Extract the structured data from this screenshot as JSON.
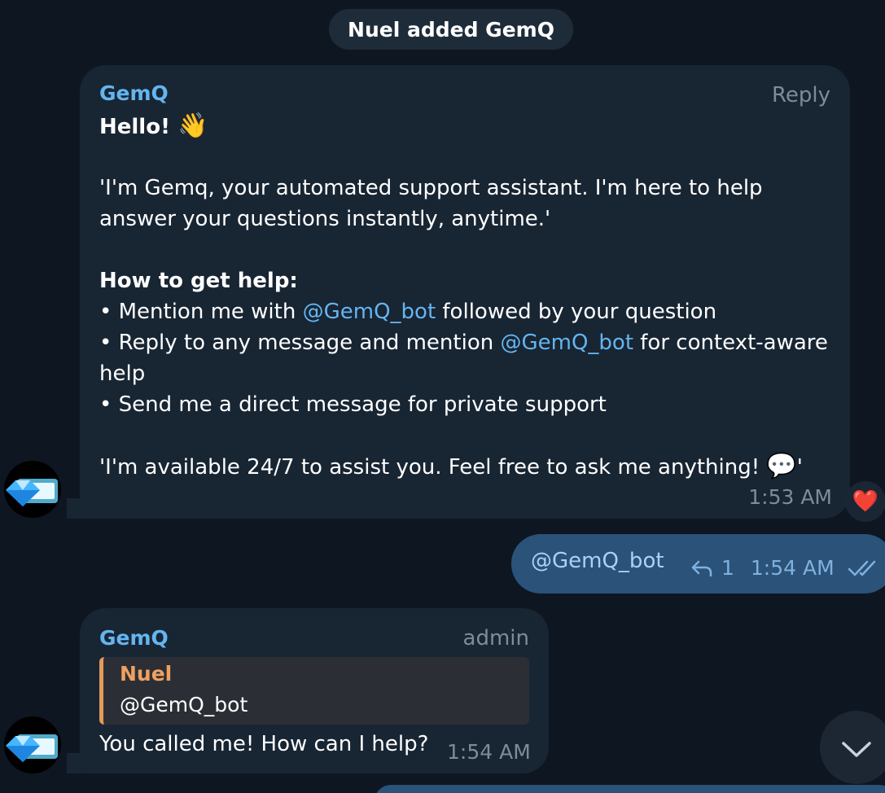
{
  "service_message": "Nuel added GemQ",
  "message1": {
    "sender": "GemQ",
    "reply_label": "Reply",
    "greeting": "Hello!",
    "greeting_emoji": "👋",
    "intro_line1": "'I'm Gemq, your automated support assistant. I'm here to help",
    "intro_line2": "answer your questions instantly, anytime.'",
    "how_to_title": "How to get help:",
    "bullet1_pre": "• Mention me with ",
    "bullet1_mention": "@GemQ_bot",
    "bullet1_post": " followed by your question",
    "bullet2_pre": "• Reply to any message and mention ",
    "bullet2_mention": "@GemQ_bot",
    "bullet2_post": " for context-aware",
    "bullet2_cont": "help",
    "bullet3": "• Send me a direct message for private support",
    "closing": "'I'm available 24/7 to assist you. Feel free to ask me anything!",
    "closing_emoji": "💬",
    "closing_end": "'",
    "time": "1:53 AM",
    "reaction": "❤️"
  },
  "outgoing": {
    "text": "@GemQ_bot",
    "reply_count": "1",
    "time": "1:54 AM",
    "status": "read"
  },
  "message2": {
    "sender": "GemQ",
    "role_label": "admin",
    "quote_name": "Nuel",
    "quote_text": "@GemQ_bot",
    "text": "You called me! How can I help?",
    "time": "1:54 AM"
  },
  "colors": {
    "background": "#0e1621",
    "incoming_bubble": "#182533",
    "outgoing_bubble": "#2b5278",
    "accent": "#64b5ef",
    "quote_accent": "#e39b5a"
  }
}
